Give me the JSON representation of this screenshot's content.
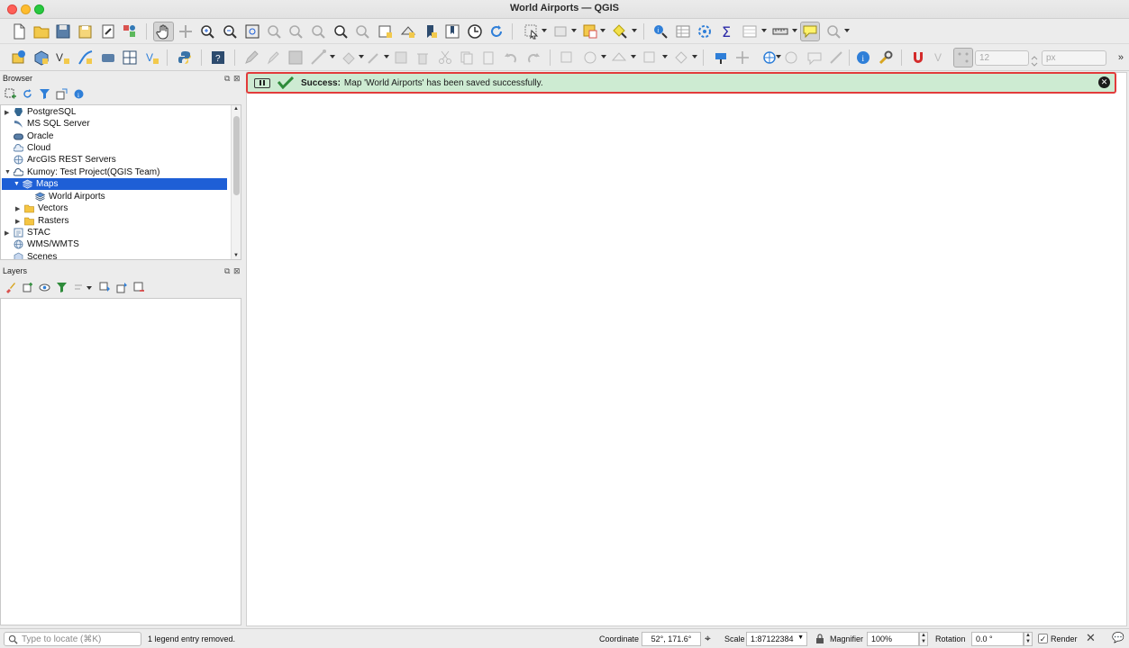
{
  "window": {
    "title": "World Airports — QGIS"
  },
  "toolbar_row1": {
    "icons": [
      "new-project",
      "open-project",
      "save-project",
      "save-as",
      "print-layout",
      "style-manager",
      "pan",
      "pan-to-selection",
      "zoom-in",
      "zoom-out",
      "zoom-full",
      "zoom-to-selection",
      "zoom-to-layer",
      "zoom-native",
      "zoom-last",
      "zoom-next",
      "new-bookmark",
      "show-bookmarks",
      "temporal",
      "refresh",
      "identify",
      "select",
      "deselect",
      "measure",
      "annotation"
    ]
  },
  "toolbar_row2": {
    "snapping_tolerance": "12",
    "snapping_unit": "px"
  },
  "browser": {
    "title": "Browser",
    "items": [
      {
        "label": "PostgreSQL",
        "icon": "postgres-icon",
        "depth": 0,
        "arrow": "right"
      },
      {
        "label": "MS SQL Server",
        "icon": "mssql-icon",
        "depth": 0,
        "arrow": ""
      },
      {
        "label": "Oracle",
        "icon": "oracle-icon",
        "depth": 0,
        "arrow": ""
      },
      {
        "label": "Cloud",
        "icon": "cloud-icon",
        "depth": 0,
        "arrow": ""
      },
      {
        "label": "ArcGIS REST Servers",
        "icon": "arcgis-icon",
        "depth": 0,
        "arrow": ""
      },
      {
        "label": "Kumoy: Test Project(QGIS Team)",
        "icon": "kumoy-icon",
        "depth": 0,
        "arrow": "down"
      },
      {
        "label": "Maps",
        "icon": "layers-stack-icon",
        "depth": 1,
        "arrow": "down",
        "selected": true
      },
      {
        "label": "World Airports",
        "icon": "layers-stack-icon",
        "depth": 2,
        "arrow": ""
      },
      {
        "label": "Vectors",
        "icon": "folder-icon",
        "depth": 1,
        "arrow": "right"
      },
      {
        "label": "Rasters",
        "icon": "folder-icon",
        "depth": 1,
        "arrow": "right"
      },
      {
        "label": "STAC",
        "icon": "stac-icon",
        "depth": 0,
        "arrow": "right"
      },
      {
        "label": "WMS/WMTS",
        "icon": "globe-icon",
        "depth": 0,
        "arrow": ""
      },
      {
        "label": "Scenes",
        "icon": "scenes-icon",
        "depth": 0,
        "arrow": ""
      }
    ]
  },
  "layers": {
    "title": "Layers"
  },
  "message": {
    "title": "Success:",
    "text": "Map 'World Airports' has been saved successfully.",
    "colors": {
      "background": "#cdebd2",
      "border": "#e23b3b"
    }
  },
  "status": {
    "locator_placeholder": "Type to locate (⌘K)",
    "message": "1 legend entry removed.",
    "coordinate_label": "Coordinate",
    "coordinate_value": "52°, 171.6°",
    "scale_label": "Scale",
    "scale_value": "1:87122384",
    "magnifier_label": "Magnifier",
    "magnifier_value": "100%",
    "rotation_label": "Rotation",
    "rotation_value": "0.0 °",
    "render_label": "Render"
  }
}
